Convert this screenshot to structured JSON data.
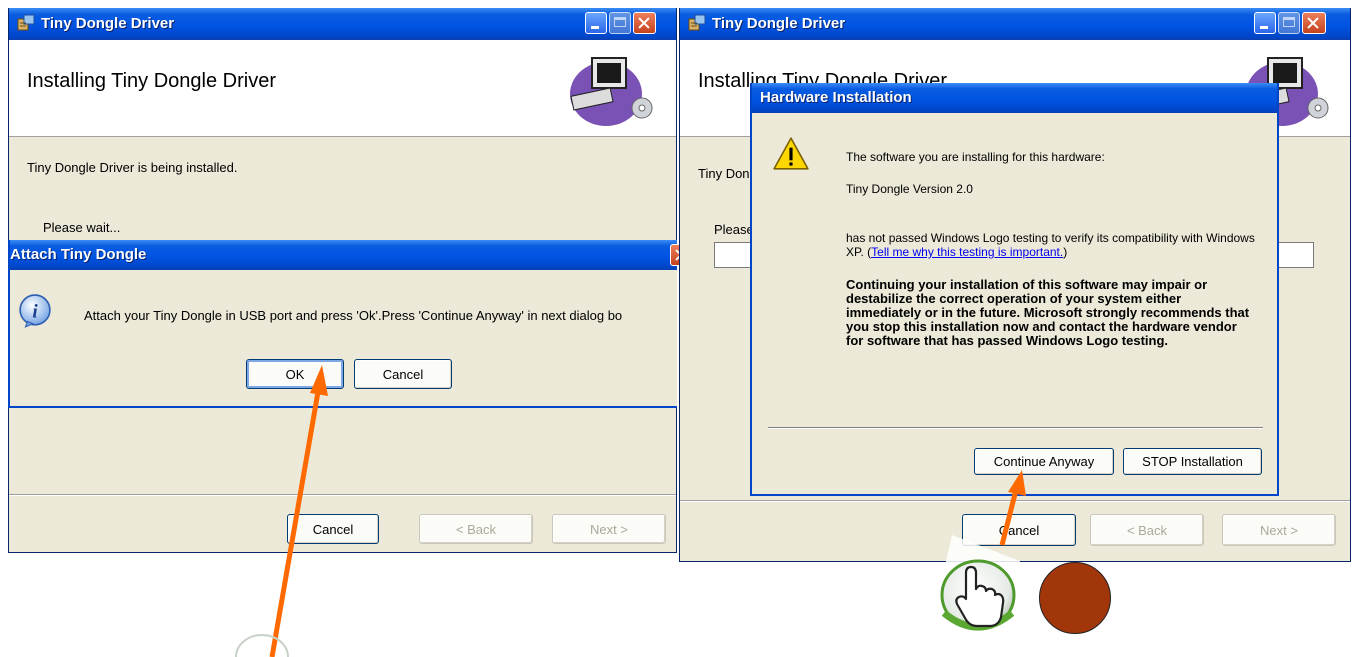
{
  "left_window": {
    "title": "Tiny Dongle Driver",
    "header_title": "Installing Tiny Dongle Driver",
    "status_text": "Tiny Dongle Driver is being installed.",
    "wait_text": "Please wait...",
    "buttons": {
      "cancel": "Cancel",
      "back": "< Back",
      "next": "Next >"
    }
  },
  "attach_dialog": {
    "title": "Attach Tiny Dongle",
    "message": "Attach your Tiny Dongle in USB port and press 'Ok'.Press 'Continue Anyway' in next dialog bo",
    "buttons": {
      "ok": "OK",
      "cancel": "Cancel"
    }
  },
  "right_window": {
    "title": "Tiny Dongle Driver",
    "header_title": "Installing Tiny Dongle Driver",
    "status_text": "Tiny Dongle Driver is being installed.",
    "wait_text": "Please wait...",
    "buttons": {
      "cancel": "Cancel",
      "back": "< Back",
      "next": "Next >"
    }
  },
  "hardware_dialog": {
    "title": "Hardware Installation",
    "line1": "The software you are installing for this hardware:",
    "product": "Tiny Dongle Version 2.0",
    "line2": "has not passed Windows Logo testing to verify its compatibility with Windows XP.",
    "link": "Tell me why this testing is important.",
    "warning": "Continuing your installation of this software may impair or destabilize the correct operation of your system either immediately or in the future. Microsoft strongly recommends that you stop this installation now and contact the hardware vendor for software that has passed Windows Logo testing.",
    "buttons": {
      "continue": "Continue Anyway",
      "stop": "STOP Installation"
    }
  },
  "annotations": {
    "arrow_color": "#ff6a00",
    "circle_color": "#a0360a"
  }
}
